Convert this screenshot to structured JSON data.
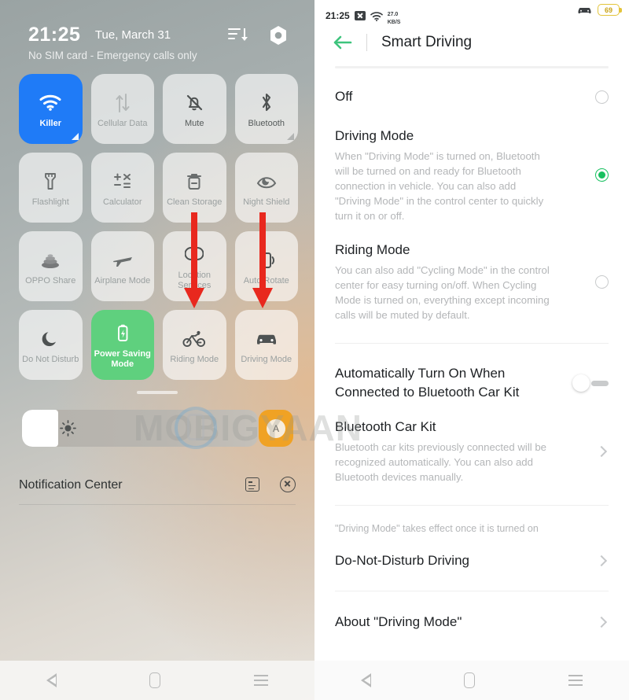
{
  "left_panel": {
    "clock": "21:25",
    "date": "Tue, March 31",
    "sim_status": "No SIM card - Emergency calls only",
    "sort_icon": "sort-icon",
    "settings_icon": "gear-icon",
    "tiles": [
      {
        "label": "Killer",
        "icon": "wifi-icon",
        "state": "on",
        "flag": true
      },
      {
        "label": "Cellular Data",
        "icon": "cellular-data-icon",
        "state": "dim",
        "flag": false
      },
      {
        "label": "Mute",
        "icon": "mute-bell-icon",
        "state": "strong",
        "flag": false
      },
      {
        "label": "Bluetooth",
        "icon": "bluetooth-icon",
        "state": "strong",
        "flag": true
      },
      {
        "label": "Flashlight",
        "icon": "flashlight-icon",
        "state": "dim",
        "flag": false
      },
      {
        "label": "Calculator",
        "icon": "calculator-icon",
        "state": "dim",
        "flag": false
      },
      {
        "label": "Clean Storage",
        "icon": "trash-clean-icon",
        "state": "dim",
        "flag": false
      },
      {
        "label": "Night Shield",
        "icon": "night-shield-icon",
        "state": "dim",
        "flag": false
      },
      {
        "label": "OPPO Share",
        "icon": "oppo-share-icon",
        "state": "dim",
        "flag": false
      },
      {
        "label": "Airplane Mode",
        "icon": "airplane-icon",
        "state": "dim",
        "flag": false
      },
      {
        "label": "Location Services",
        "icon": "location-icon",
        "state": "dim",
        "flag": false
      },
      {
        "label": "Auto Rotate",
        "icon": "auto-rotate-icon",
        "state": "dim",
        "flag": false
      },
      {
        "label": "Do Not Disturb",
        "icon": "moon-icon",
        "state": "dim",
        "flag": false
      },
      {
        "label": "Power Saving Mode",
        "icon": "battery-bolt-icon",
        "state": "green",
        "flag": false
      },
      {
        "label": "Riding Mode",
        "icon": "bicycle-icon",
        "state": "dim",
        "flag": false
      },
      {
        "label": "Driving Mode",
        "icon": "car-icon",
        "state": "dim",
        "flag": false
      }
    ],
    "brightness": {
      "icon": "brightness-icon",
      "auto_label": "A",
      "fill_percent": 15
    },
    "notification_center": {
      "title": "Notification Center",
      "manage_icon": "notification-manage-icon",
      "clear_icon": "clear-all-icon"
    }
  },
  "right_panel": {
    "status_bar": {
      "time": "21:25",
      "nosim_icon": "no-sim-icon",
      "wifi_icon": "wifi-icon",
      "net_speed_value": "27.0",
      "net_speed_unit": "KB/S",
      "car_icon": "driving-mode-car-icon",
      "battery_level": "69"
    },
    "header": {
      "back_icon": "back-arrow-icon",
      "title": "Smart Driving"
    },
    "options": [
      {
        "title": "Off",
        "desc": "",
        "control": "radio",
        "selected": false
      },
      {
        "title": "Driving Mode",
        "desc": "When \"Driving Mode\" is turned on, Bluetooth will be turned on and ready for Bluetooth connection in vehicle. You can also add \"Driving Mode\" in the control center to quickly turn it on or off.",
        "control": "radio",
        "selected": true
      },
      {
        "title": "Riding Mode",
        "desc": "You can also add \"Cycling Mode\" in the control center for easy turning on/off. When Cycling Mode is turned on, everything except incoming calls will be muted by default.",
        "control": "radio",
        "selected": false
      }
    ],
    "settings": [
      {
        "title": "Automatically Turn On When Connected to Bluetooth Car Kit",
        "desc": "",
        "control": "toggle",
        "on": false
      },
      {
        "title": "Bluetooth Car Kit",
        "desc": "Bluetooth car kits previously connected will be recognized automatically. You can also add Bluetooth devices manually.",
        "control": "chevron"
      }
    ],
    "note": "\"Driving Mode\" takes effect once it is turned on",
    "links": [
      {
        "title": "Do-Not-Disturb Driving",
        "control": "chevron"
      },
      {
        "title": "About \"Driving Mode\"",
        "control": "chevron"
      }
    ]
  },
  "nav_bar": {
    "back_icon": "nav-back-icon",
    "home_icon": "nav-home-icon",
    "recents_icon": "nav-recents-icon"
  },
  "watermark": {
    "text": "MOBIGYAAN"
  },
  "colors": {
    "accent_blue": "#1f7bf7",
    "accent_green": "#5fd07e",
    "radio_green": "#17c05f",
    "arrow_red": "#e8281e",
    "auto_orange": "#f0a224",
    "battery_yellow": "#e3c43a"
  }
}
